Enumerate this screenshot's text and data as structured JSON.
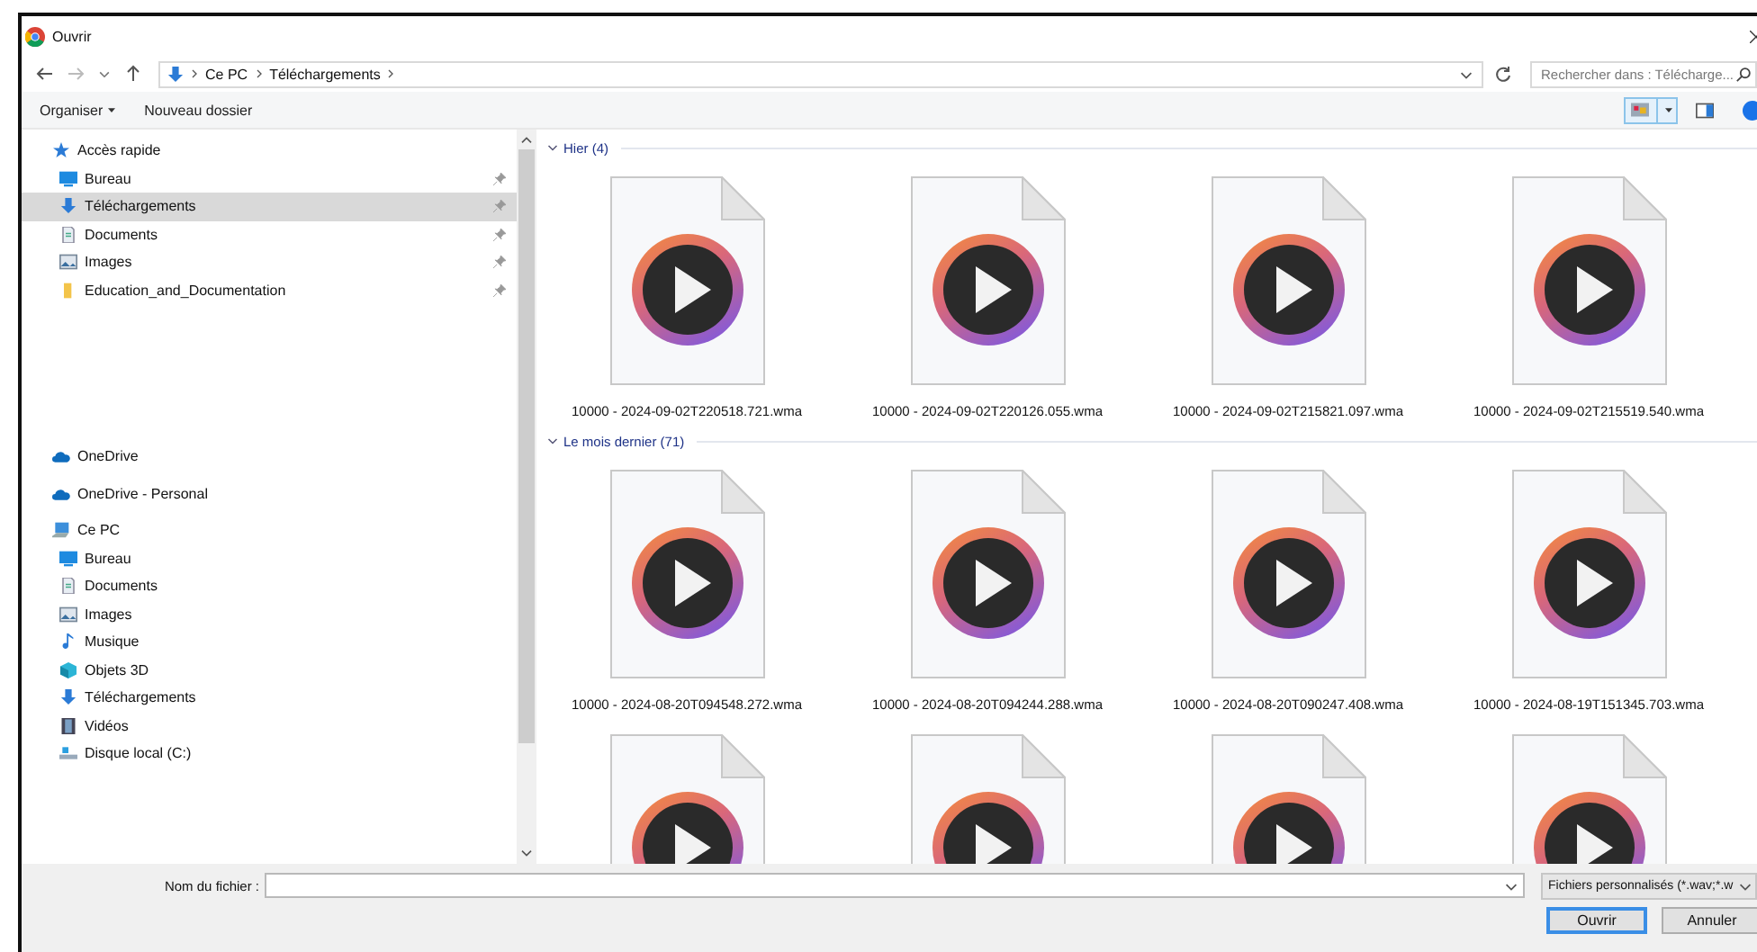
{
  "window": {
    "title": "Ouvrir"
  },
  "address_bar": {
    "path": [
      {
        "label": "Ce PC"
      },
      {
        "label": "Téléchargements"
      }
    ]
  },
  "search": {
    "placeholder": "Rechercher dans : Télécharge..."
  },
  "toolbar": {
    "buttons": [
      {
        "label": "Organiser",
        "dropdown": true
      },
      {
        "label": "Nouveau dossier",
        "dropdown": false
      }
    ]
  },
  "sidebar": {
    "sections": [
      {
        "label": "Accès rapide",
        "kind": "star",
        "children": [
          {
            "label": "Bureau",
            "kind": "desktop",
            "pinned": true,
            "selected": false
          },
          {
            "label": "Téléchargements",
            "kind": "download",
            "pinned": true,
            "selected": true
          },
          {
            "label": "Documents",
            "kind": "document",
            "pinned": true,
            "selected": false
          },
          {
            "label": "Images",
            "kind": "image",
            "pinned": true,
            "selected": false
          },
          {
            "label": "Education_and_Documentation",
            "kind": "folder",
            "pinned": true,
            "selected": false
          }
        ]
      },
      {
        "label": "OneDrive",
        "kind": "cloud"
      },
      {
        "label": "OneDrive - Personal",
        "kind": "cloud"
      },
      {
        "label": "Ce PC",
        "kind": "pc",
        "children": [
          {
            "label": "Bureau",
            "kind": "desktop",
            "pinned": false,
            "selected": false
          },
          {
            "label": "Documents",
            "kind": "document",
            "pinned": false,
            "selected": false
          },
          {
            "label": "Images",
            "kind": "image",
            "pinned": false,
            "selected": false
          },
          {
            "label": "Musique",
            "kind": "music",
            "pinned": false,
            "selected": false
          },
          {
            "label": "Objets 3D",
            "kind": "cube",
            "pinned": false,
            "selected": false
          },
          {
            "label": "Téléchargements",
            "kind": "download",
            "pinned": false,
            "selected": false
          },
          {
            "label": "Vidéos",
            "kind": "video",
            "pinned": false,
            "selected": false
          },
          {
            "label": "Disque local (C:)",
            "kind": "drive",
            "pinned": false,
            "selected": false
          }
        ]
      }
    ]
  },
  "groups": [
    {
      "title": "Hier (4)",
      "expanded": true,
      "files": [
        {
          "kind": "audio",
          "name": "10000 - 2024-09-02T220518.721.wma"
        },
        {
          "kind": "audio",
          "name": "10000 - 2024-09-02T220126.055.wma"
        },
        {
          "kind": "audio",
          "name": "10000 - 2024-09-02T215821.097.wma"
        },
        {
          "kind": "audio",
          "name": "10000 - 2024-09-02T215519.540.wma"
        }
      ]
    },
    {
      "title": "Le mois dernier (71)",
      "expanded": true,
      "files": [
        {
          "kind": "audio",
          "name": "10000 - 2024-08-20T094548.272.wma"
        },
        {
          "kind": "audio",
          "name": "10000 - 2024-08-20T094244.288.wma"
        },
        {
          "kind": "audio",
          "name": "10000 - 2024-08-20T090247.408.wma"
        },
        {
          "kind": "audio",
          "name": "10000 - 2024-08-19T151345.703.wma"
        },
        {
          "kind": "audio"
        },
        {
          "kind": "audio"
        },
        {
          "kind": "audio"
        },
        {
          "kind": "audio"
        }
      ]
    }
  ],
  "footer": {
    "filename_label": "Nom du fichier :",
    "filter": "Fichiers personnalisés (*.wav;*.w",
    "buttons": [
      {
        "label": "Ouvrir",
        "default": true
      },
      {
        "label": "Annuler",
        "default": false
      }
    ]
  }
}
